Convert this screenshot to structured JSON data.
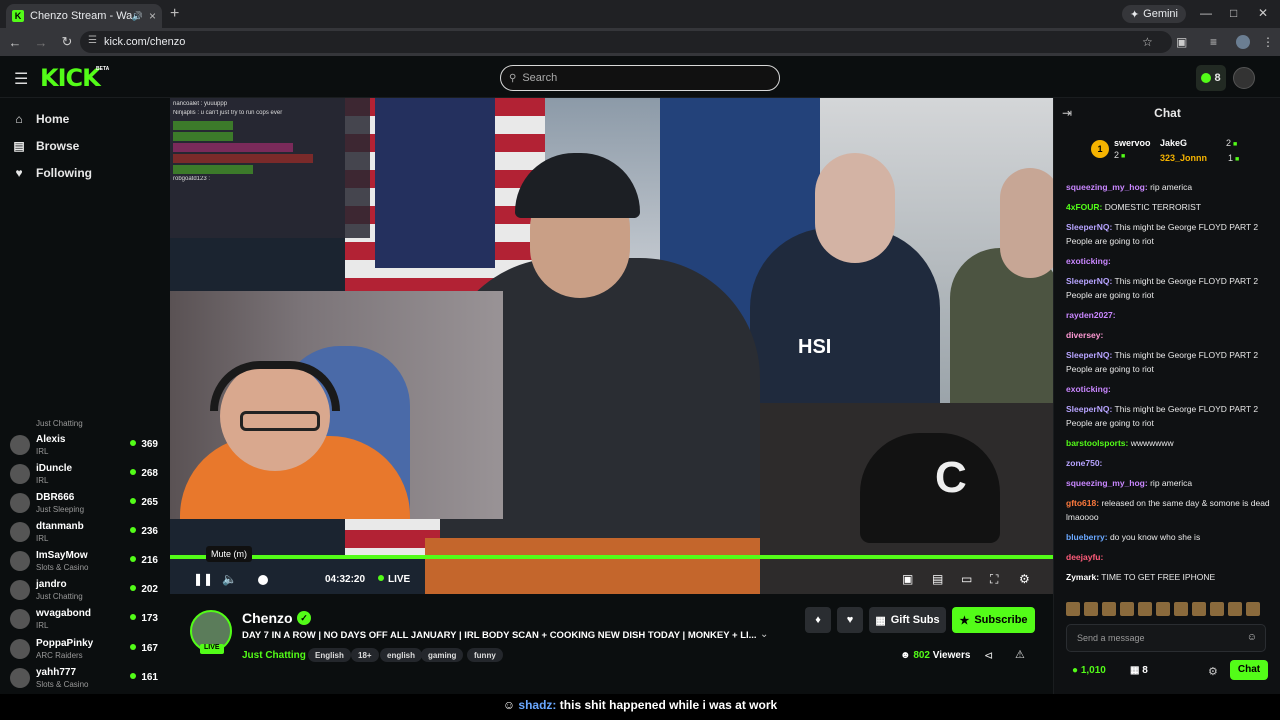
{
  "browser": {
    "tab_title": "Chenzo Stream - Watch Live",
    "gemini_label": "Gemini",
    "url": "kick.com/chenzo"
  },
  "header": {
    "logo": "KICK",
    "beta": "BETA",
    "search_placeholder": "Search",
    "points": "8"
  },
  "sidebar": {
    "nav": [
      {
        "label": "Home",
        "icon": "home-icon"
      },
      {
        "label": "Browse",
        "icon": "browse-icon"
      },
      {
        "label": "Following",
        "icon": "heart-icon"
      }
    ],
    "first_category": "Just Chatting",
    "channels": [
      {
        "name": "Alexis",
        "category": "IRL",
        "viewers": "369"
      },
      {
        "name": "iDuncle",
        "category": "IRL",
        "viewers": "268"
      },
      {
        "name": "DBR666",
        "category": "Just Sleeping",
        "viewers": "265"
      },
      {
        "name": "dtanmanb",
        "category": "IRL",
        "viewers": "236"
      },
      {
        "name": "ImSayMow",
        "category": "Slots & Casino",
        "viewers": "216"
      },
      {
        "name": "jandro",
        "category": "Just Chatting",
        "viewers": "202"
      },
      {
        "name": "wvagabond",
        "category": "IRL",
        "viewers": "173"
      },
      {
        "name": "PoppaPinky",
        "category": "ARC Raiders",
        "viewers": "167"
      },
      {
        "name": "yahh777",
        "category": "Slots & Casino",
        "viewers": "161"
      }
    ]
  },
  "video": {
    "hsi_text": "HSI",
    "overlay_lines": [
      "nancoalet : yuuuppp",
      "Ninjaplis : u can't just try to run cops ever",
      "",
      "",
      "",
      "",
      "",
      "",
      "robgoatd123 :"
    ],
    "player": {
      "tooltip": "Mute (m)",
      "time": "04:32:20",
      "live_label": "LIVE"
    }
  },
  "stream": {
    "name": "Chenzo",
    "live_badge": "LIVE",
    "title": "DAY 7 IN A ROW | NO DAYS OFF ALL JANUARY | IRL BODY SCAN + COOKING NEW DISH TODAY | MONKEY + LI...",
    "category": "Just Chatting",
    "tags": [
      "English",
      "18+",
      "english",
      "gaming",
      "funny"
    ],
    "gift_label": "Gift Subs",
    "subscribe_label": "Subscribe",
    "viewers_count": "802",
    "viewers_label": "Viewers"
  },
  "caption": {
    "user": "shadz:",
    "text": "this shit happened while i was at work"
  },
  "chat": {
    "title": "Chat",
    "leaderboard": {
      "rank": "1",
      "first_name": "swervoo",
      "first_count": "2",
      "second_name": "JakeG",
      "second_count": "2",
      "third_name": "323_Jonnn",
      "third_count": "1"
    },
    "messages": [
      {
        "user": "squeezing_my_hog:",
        "text": "rip america",
        "color": "#c987ff"
      },
      {
        "user": "4xFOUR:",
        "text": "DOMESTIC TERRORIST",
        "color": "#53fc18"
      },
      {
        "user": "SleeperNQ:",
        "text": "This might be George FLOYD PART 2 People are going to riot",
        "color": "#b7a4ff"
      },
      {
        "user": "exoticking:",
        "text": "",
        "color": "#c987ff"
      },
      {
        "user": "SleeperNQ:",
        "text": "This might be George FLOYD PART 2 People are going to riot",
        "color": "#b7a4ff"
      },
      {
        "user": "rayden2027:",
        "text": "",
        "color": "#c987ff"
      },
      {
        "user": "diversey:",
        "text": "",
        "color": "#ff9ad5"
      },
      {
        "user": "SleeperNQ:",
        "text": "This might be George FLOYD PART 2 People are going to riot",
        "color": "#b7a4ff"
      },
      {
        "user": "exoticking:",
        "text": "",
        "color": "#c987ff"
      },
      {
        "user": "SleeperNQ:",
        "text": "This might be George FLOYD PART 2 People are going to riot",
        "color": "#b7a4ff"
      },
      {
        "user": "barstoolsports:",
        "text": "wwwwwww",
        "color": "#53fc18"
      },
      {
        "user": "zone750:",
        "text": "",
        "color": "#b7a4ff"
      },
      {
        "user": "squeezing_my_hog:",
        "text": "rip america",
        "color": "#c987ff"
      },
      {
        "user": "gfto618:",
        "text": "released on the same day & somone is dead lmaoooo",
        "color": "#ff7a3d"
      },
      {
        "user": "blueberry:",
        "text": "do you know who she is",
        "color": "#6aa8ff"
      },
      {
        "user": "deejayfu:",
        "text": "",
        "color": "#ff5c7a"
      },
      {
        "user": "Zymark:",
        "text": "TIME TO GET FREE IPHONE",
        "color": "#ffffff"
      }
    ],
    "send_placeholder": "Send a message",
    "points_balance": "1,010",
    "gifts_count": "8",
    "chat_button": "Chat"
  }
}
